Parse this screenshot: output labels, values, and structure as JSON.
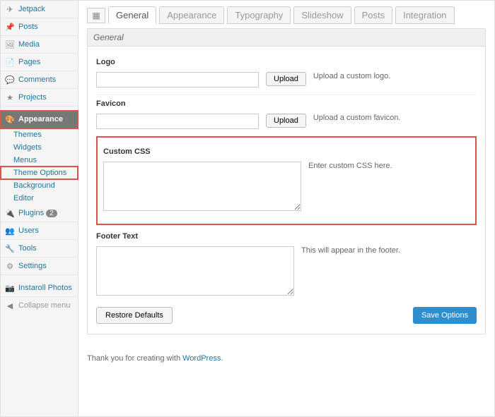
{
  "sidebar": {
    "items": [
      {
        "label": "Jetpack"
      },
      {
        "label": "Posts"
      },
      {
        "label": "Media"
      },
      {
        "label": "Pages"
      },
      {
        "label": "Comments"
      },
      {
        "label": "Projects"
      },
      {
        "label": "Appearance"
      },
      {
        "label": "Plugins",
        "badge": "2"
      },
      {
        "label": "Users"
      },
      {
        "label": "Tools"
      },
      {
        "label": "Settings"
      },
      {
        "label": "Instaroll Photos"
      }
    ],
    "subitems": [
      {
        "label": "Themes"
      },
      {
        "label": "Widgets"
      },
      {
        "label": "Menus"
      },
      {
        "label": "Theme Options"
      },
      {
        "label": "Background"
      },
      {
        "label": "Editor"
      }
    ],
    "collapse": "Collapse menu"
  },
  "tabs": [
    {
      "label": "General"
    },
    {
      "label": "Appearance"
    },
    {
      "label": "Typography"
    },
    {
      "label": "Slideshow"
    },
    {
      "label": "Posts"
    },
    {
      "label": "Integration"
    }
  ],
  "panel": {
    "title": "General",
    "logo": {
      "label": "Logo",
      "upload": "Upload",
      "hint": "Upload a custom logo."
    },
    "favicon": {
      "label": "Favicon",
      "upload": "Upload",
      "hint": "Upload a custom favicon."
    },
    "css": {
      "label": "Custom CSS",
      "hint": "Enter custom CSS here."
    },
    "footer": {
      "label": "Footer Text",
      "hint": "This will appear in the footer."
    },
    "restore": "Restore Defaults",
    "save": "Save Options"
  },
  "credit": {
    "text": "Thank you for creating with ",
    "link": "WordPress"
  }
}
